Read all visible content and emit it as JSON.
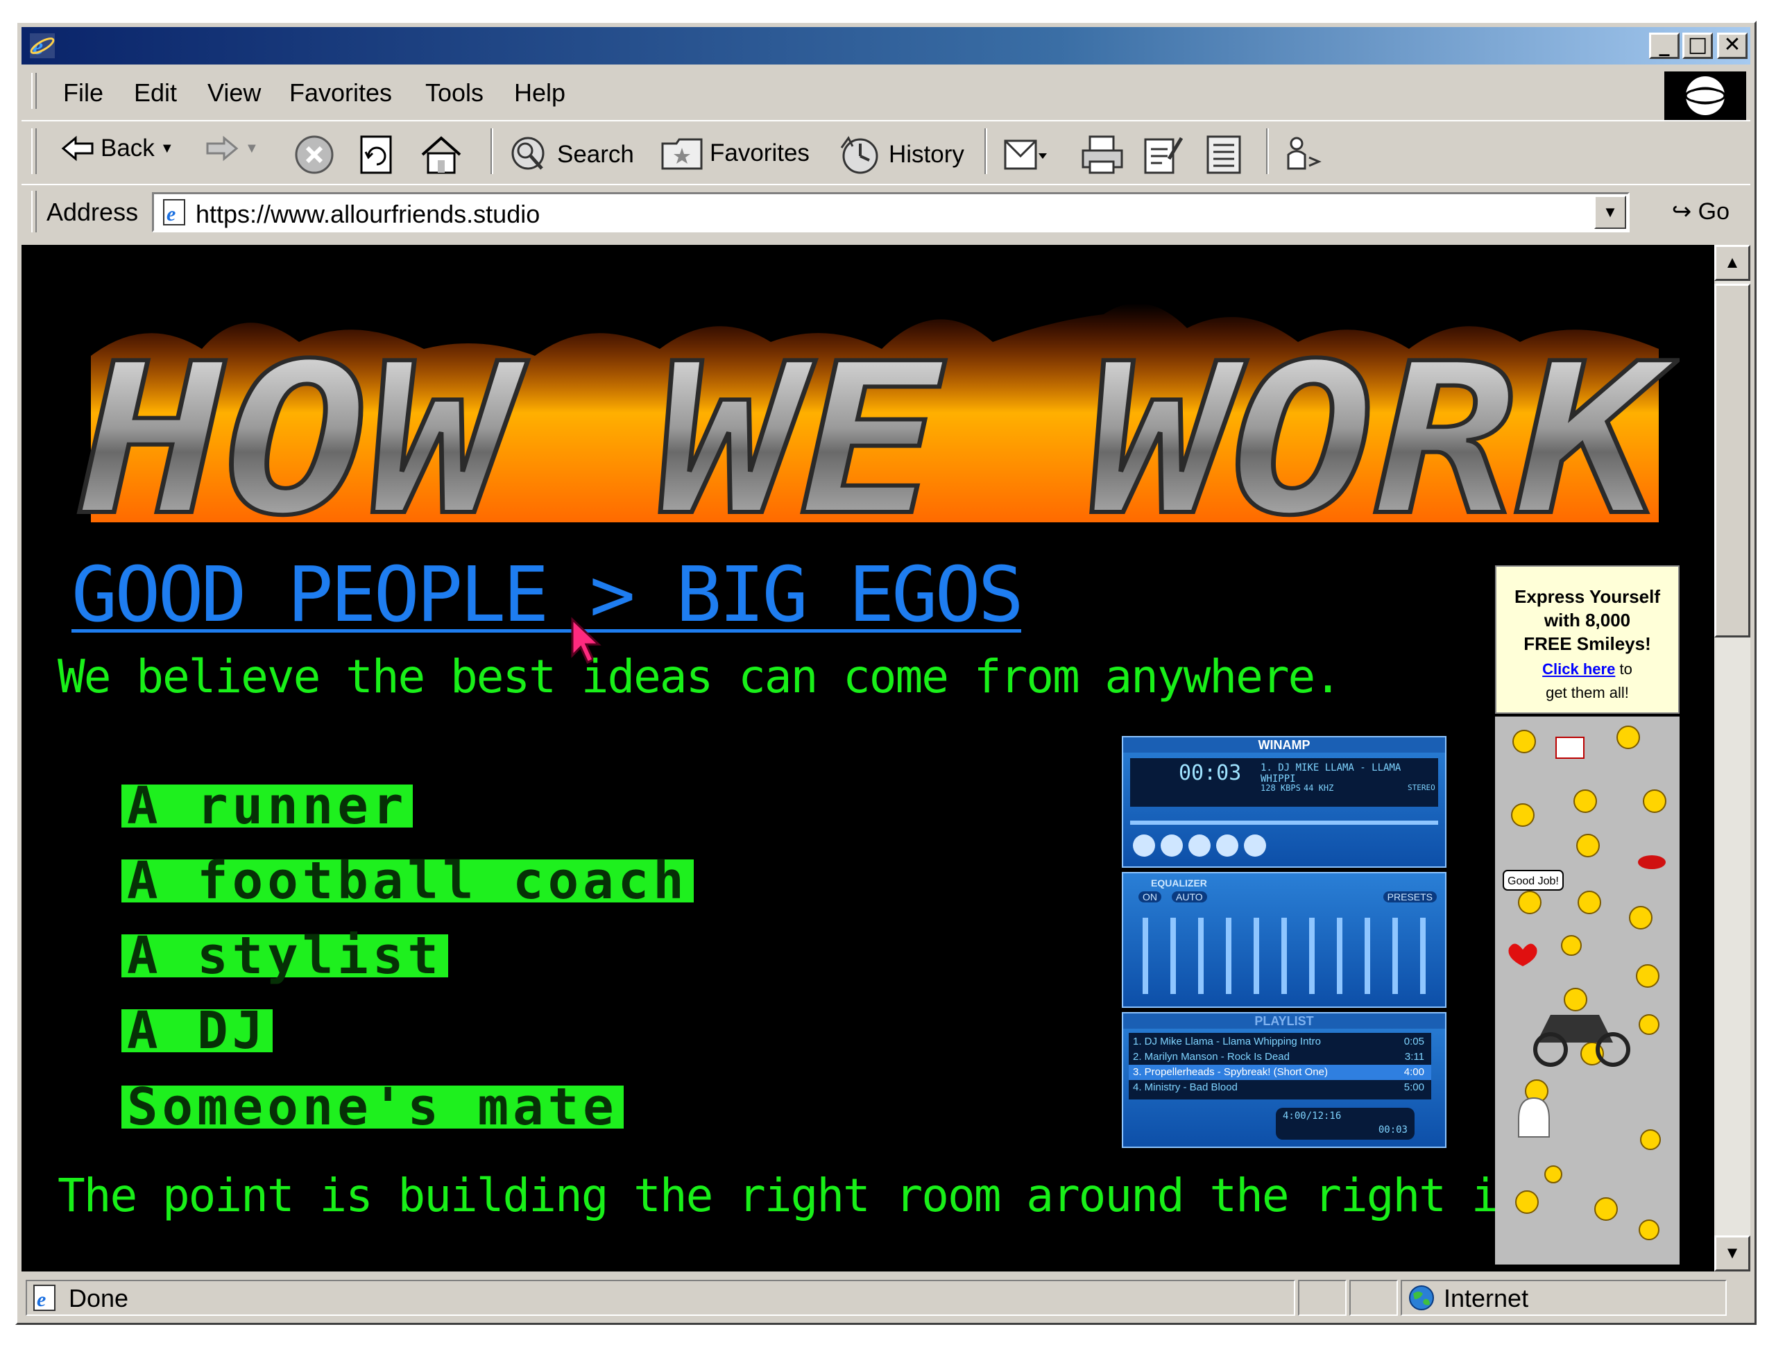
{
  "window": {
    "minimize": "_",
    "maximize": "□",
    "close": "✕"
  },
  "menu": [
    "File",
    "Edit",
    "View",
    "Favorites",
    "Tools",
    "Help"
  ],
  "toolbar": {
    "back": "Back",
    "search": "Search",
    "favorites": "Favorites",
    "history": "History"
  },
  "address": {
    "label": "Address",
    "url": "https://www.allourfriends.studio",
    "go": "Go"
  },
  "page": {
    "banner": "HOW WE WORK",
    "tagline": "GOOD PEOPLE > BIG EGOS",
    "intro": "We believe the best ideas can come from anywhere.",
    "roles": [
      "A runner",
      "A football coach",
      "A stylist",
      "A DJ",
      "Someone's mate"
    ],
    "outro": "The point is building the right room around the right idea."
  },
  "ad": {
    "headline_1": "Express Yourself",
    "headline_2": "with 8,000",
    "headline_3": "FREE Smileys!",
    "link": "Click here",
    "rest_1": "to",
    "rest_2": "get them all!",
    "speech": "Good Job!"
  },
  "winamp": {
    "title": "WINAMP",
    "time": "00:03",
    "track": "1. DJ MIKE LLAMA - LLAMA WHIPPI",
    "kbps": "128",
    "kbps_label": "KBPS",
    "khz": "44",
    "khz_label": "KHZ",
    "stereo": "STEREO",
    "eq_title": "EQUALIZER",
    "eq_on": "ON",
    "eq_auto": "AUTO",
    "eq_presets": "PRESETS",
    "playlist_title": "PLAYLIST",
    "playlist": [
      {
        "name": "1. DJ Mike Llama - Llama Whipping Intro",
        "time": "0:05"
      },
      {
        "name": "2. Marilyn Manson - Rock Is Dead",
        "time": "3:11"
      },
      {
        "name": "3. Propellerheads - Spybreak! (Short One)",
        "time": "4:00"
      },
      {
        "name": "4. Ministry - Bad Blood",
        "time": "5:00"
      }
    ],
    "total": "4:00/12:16",
    "elapsed": "00:03"
  },
  "status": {
    "text": "Done",
    "zone": "Internet"
  },
  "colors": {
    "title_start": "#0a246a",
    "tagline": "#1e7df0",
    "green": "#19f019",
    "role_bg": "#1ef01e"
  }
}
